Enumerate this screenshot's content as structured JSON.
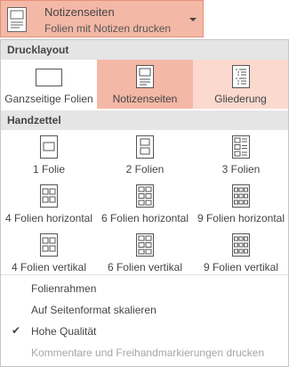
{
  "dropdown": {
    "title": "Notizenseiten",
    "subtitle": "Folien mit Notizen drucken",
    "icon": "notes-page-icon"
  },
  "print_layout": {
    "header": "Drucklayout",
    "items": [
      {
        "label": "Ganzseitige Folien",
        "icon": "full-page-slide-icon",
        "state": "normal"
      },
      {
        "label": "Notizenseiten",
        "icon": "notes-page-icon",
        "state": "selected"
      },
      {
        "label": "Gliederung",
        "icon": "outline-icon",
        "state": "hover"
      }
    ]
  },
  "handouts": {
    "header": "Handzettel",
    "items": [
      {
        "label": "1 Folie",
        "icon": "handout-1-icon"
      },
      {
        "label": "2 Folien",
        "icon": "handout-2-icon"
      },
      {
        "label": "3 Folien",
        "icon": "handout-3-icon"
      },
      {
        "label": "4 Folien horizontal",
        "icon": "handout-4h-icon"
      },
      {
        "label": "6 Folien horizontal",
        "icon": "handout-6h-icon"
      },
      {
        "label": "9 Folien horizontal",
        "icon": "handout-9h-icon"
      },
      {
        "label": "4 Folien vertikal",
        "icon": "handout-4v-icon"
      },
      {
        "label": "6 Folien vertikal",
        "icon": "handout-6v-icon"
      },
      {
        "label": "9 Folien vertikal",
        "icon": "handout-9v-icon"
      }
    ]
  },
  "options": [
    {
      "label": "Folienrahmen",
      "checked": false,
      "disabled": false
    },
    {
      "label": "Auf Seitenformat skalieren",
      "checked": false,
      "disabled": false
    },
    {
      "label": "Hohe Qualität",
      "checked": true,
      "disabled": false
    },
    {
      "label": "Kommentare und Freihandmarkierungen drucken",
      "checked": false,
      "disabled": true
    }
  ],
  "colors": {
    "selected_bg": "#f4b8a6",
    "hover_bg": "#fbd9ce",
    "header_bg": "#e5e5e5"
  }
}
